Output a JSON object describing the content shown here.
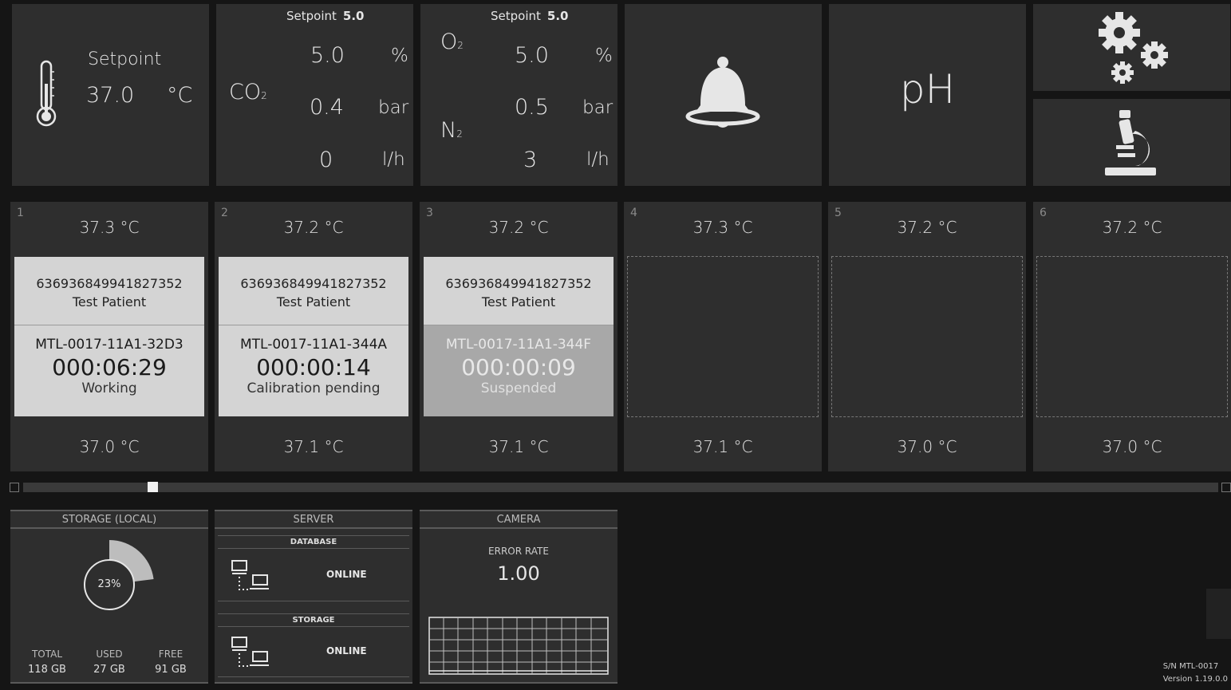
{
  "temperature": {
    "setpoint_label": "Setpoint",
    "value": "37.0",
    "unit": "°C"
  },
  "co2": {
    "setpoint_label": "Setpoint",
    "setpoint_value": "5.0",
    "gas": "CO",
    "gas_sub": "2",
    "percent_value": "5.0",
    "percent_unit": "%",
    "pressure_value": "0.4",
    "pressure_unit": "bar",
    "flow_value": "0",
    "flow_unit": "l/h"
  },
  "o2": {
    "setpoint_label": "Setpoint",
    "setpoint_value": "5.0",
    "gas_o": "O",
    "gas_o_sub": "2",
    "gas_n": "N",
    "gas_n_sub": "2",
    "percent_value": "5.0",
    "percent_unit": "%",
    "pressure_value": "0.5",
    "pressure_unit": "bar",
    "flow_value": "3",
    "flow_unit": "l/h"
  },
  "ph": {
    "label": "pH"
  },
  "chambers": [
    {
      "number": "1",
      "top_temp": "37.3 °C",
      "bottom_temp": "37.0 °C",
      "occupied": true,
      "patient_id": "636936849941827352",
      "patient_name": "Test Patient",
      "dish_id": "MTL-0017-11A1-32D3",
      "elapsed": "000:06:29",
      "status": "Working"
    },
    {
      "number": "2",
      "top_temp": "37.2 °C",
      "bottom_temp": "37.1 °C",
      "occupied": true,
      "patient_id": "636936849941827352",
      "patient_name": "Test Patient",
      "dish_id": "MTL-0017-11A1-344A",
      "elapsed": "000:00:14",
      "status": "Calibration pending"
    },
    {
      "number": "3",
      "top_temp": "37.2 °C",
      "bottom_temp": "37.1 °C",
      "occupied": true,
      "patient_id": "636936849941827352",
      "patient_name": "Test Patient",
      "dish_id": "MTL-0017-11A1-344F",
      "elapsed": "000:00:09",
      "status": "Suspended"
    },
    {
      "number": "4",
      "top_temp": "37.3 °C",
      "bottom_temp": "37.1 °C",
      "occupied": false
    },
    {
      "number": "5",
      "top_temp": "37.2 °C",
      "bottom_temp": "37.0 °C",
      "occupied": false
    },
    {
      "number": "6",
      "top_temp": "37.2 °C",
      "bottom_temp": "37.0 °C",
      "occupied": false
    }
  ],
  "slider": {
    "position_fraction": 0.104
  },
  "storage": {
    "title": "STORAGE (LOCAL)",
    "used_percent": 23,
    "used_label": "23%",
    "total_label": "TOTAL",
    "total_value": "118 GB",
    "used_col_label": "USED",
    "used_value": "27 GB",
    "free_label": "FREE",
    "free_value": "91 GB"
  },
  "server": {
    "title": "SERVER",
    "database_title": "DATABASE",
    "database_status": "ONLINE",
    "storage_title": "STORAGE",
    "storage_status": "ONLINE"
  },
  "camera": {
    "title": "CAMERA",
    "error_label": "ERROR RATE",
    "error_value": "1.00"
  },
  "footer": {
    "serial": "S/N MTL-0017",
    "version": "Version 1.19.0.0"
  },
  "icons": {
    "thermometer": "thermometer-icon",
    "bell": "bell-icon",
    "gears": "gears-icon",
    "microscope": "microscope-icon",
    "network": "network-computer-icon"
  }
}
